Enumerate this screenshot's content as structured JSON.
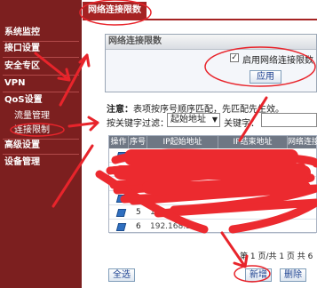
{
  "sidebar": {
    "items": [
      {
        "label": "系统监控"
      },
      {
        "label": "接口设置"
      },
      {
        "label": "安全专区"
      },
      {
        "label": "VPN"
      },
      {
        "label": "QoS设置"
      },
      {
        "label": "流量管理"
      },
      {
        "label": "连接限制"
      },
      {
        "label": "高级设置"
      },
      {
        "label": "设备管理"
      }
    ]
  },
  "tab": {
    "title": "网络连接限数"
  },
  "panel": {
    "title": "网络连接限数",
    "enable_label": "启用网络连接限数",
    "enable_checked": true,
    "apply_label": "应用"
  },
  "note": {
    "prefix": "注意：",
    "text": "表项按序号顺序匹配，先匹配先生效。"
  },
  "filter": {
    "label": "按关键字过滤：",
    "selected": "起始地址",
    "keyword_label": "关键字："
  },
  "table": {
    "headers": [
      "操作",
      "序号",
      "IP起始地址",
      "IP结束地址",
      "网络连接"
    ],
    "rows": [
      {
        "no": "5",
        "ip": "192.168.55."
      },
      {
        "no": "6",
        "ip": "192.168.55."
      }
    ]
  },
  "pager": {
    "text": "第 1 页/共 1 页 共 6"
  },
  "buttons": {
    "select_all": "全选",
    "add": "新增",
    "delete": "删除"
  },
  "colors": {
    "sidebar": "#7c1f1f",
    "tab": "#a52323",
    "annotation": "#e8242b"
  }
}
